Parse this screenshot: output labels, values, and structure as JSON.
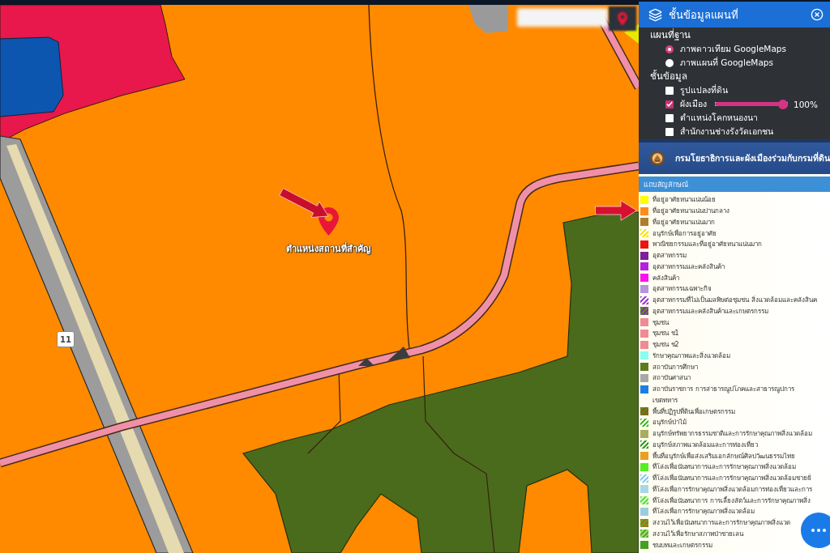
{
  "map": {
    "marker_label": "ตำแหน่งสถานที่สำคัญ",
    "road_shield": "11"
  },
  "layer_panel": {
    "title": "ชั้นข้อมูลแผนที่",
    "sections": [
      {
        "label": "แผนที่ฐาน",
        "items": [
          {
            "kind": "radio",
            "label": "ภาพดาวเทียม GoogleMaps",
            "selected": true
          },
          {
            "kind": "radio",
            "label": "ภาพแผนที่ GoogleMaps",
            "selected": false
          }
        ]
      },
      {
        "label": "ชั้นข้อมูล",
        "items": [
          {
            "kind": "checkbox",
            "label": "รูปแปลงที่ดิน",
            "checked": false
          },
          {
            "kind": "checkbox",
            "label": "ผังเมือง",
            "checked": true,
            "level": 1,
            "reading": "100%"
          },
          {
            "kind": "checkbox",
            "label": "ตำแหน่งโคกหนองนา",
            "checked": false
          },
          {
            "kind": "checkbox",
            "label": "สำนักงานช่างรังวัดเอกชน",
            "checked": false
          }
        ]
      }
    ]
  },
  "agency_banner": {
    "title": "กรมโยธาธิการและผังเมืองร่วมกับกรมที่ดิน"
  },
  "legend": {
    "title": "แถบสัญลักษณ์",
    "items": [
      {
        "kind": "solid",
        "label": "ที่อยู่อาศัยหนาแน่นน้อย",
        "color": "#ffff00"
      },
      {
        "kind": "solid",
        "label": "ที่อยู่อาศัยหนาแน่นปานกลาง",
        "color": "#ff8c1a"
      },
      {
        "kind": "solid",
        "label": "ที่อยู่อาศัยหนาแน่นมาก",
        "color": "#b07d2c"
      },
      {
        "kind": "hatched",
        "label": "อนุรักษ์เพื่อการอยู่อาศัย",
        "stripes": [
          {
            "color": "#f5e600"
          },
          {
            "color": "#ffffff"
          }
        ]
      },
      {
        "kind": "solid",
        "label": "พาณิชยกรรมและที่อยู่อาศัยหนาแน่นมาก",
        "color": "#ee1111"
      },
      {
        "kind": "solid",
        "label": "อุตสาหกรรม",
        "color": "#7a1f9a"
      },
      {
        "kind": "solid",
        "label": "อุตสาหกรรมและคลังสินค้า",
        "color": "#b51fe0"
      },
      {
        "kind": "solid",
        "label": "คลังสินค้า",
        "color": "#ff11ee"
      },
      {
        "kind": "solid",
        "label": "อุตสาหกรรมเฉพาะกิจ",
        "color": "#b594e0"
      },
      {
        "kind": "hatched",
        "label": "อุตสาหกรรมที่ไม่เป็นมลพิษต่อชุมชน สิ่งแวดล้อมและคลังสินค",
        "stripes": [
          {
            "color": "#9b3ee0"
          },
          {
            "color": "#ffffff"
          }
        ]
      },
      {
        "kind": "hatched",
        "label": "อุตสาหกรรมและคลังสินค้าและเกษตรกรรม",
        "stripes": [
          {
            "color": "#7a3a9a"
          },
          {
            "color": "#5a8a2a"
          }
        ]
      },
      {
        "kind": "solid",
        "label": "ชุมชน",
        "color": "#f08a95"
      },
      {
        "kind": "solid",
        "label": "ชุมชน ช1",
        "color": "#f08a95"
      },
      {
        "kind": "solid",
        "label": "ชุมชน ช2",
        "color": "#f08a95"
      },
      {
        "kind": "solid",
        "label": "รักษาคุณภาพและสิ่งแวดล้อม",
        "color": "#88ffee"
      },
      {
        "kind": "solid",
        "label": "สถาบันการศึกษา",
        "color": "#5b7a1e"
      },
      {
        "kind": "solid",
        "label": "สถาบันศาสนา",
        "color": "#a8a8a8"
      },
      {
        "kind": "solid",
        "label": "สถาบันราชการ การสาธารณูปโภคและสาธารณูปการ",
        "color": "#1c7ee6"
      },
      {
        "kind": "blank",
        "label": "เขตทหาร"
      },
      {
        "kind": "hatched",
        "label": "พื้นที่ปฏิรูปที่ดินเพื่อเกษตรกรรม",
        "stripes": [
          {
            "color": "#8a5a1a"
          },
          {
            "color": "#5a8a1a"
          }
        ]
      },
      {
        "kind": "hatched",
        "label": "อนุรักษ์ป่าไม้",
        "stripes": [
          {
            "color": "#44bb22"
          },
          {
            "color": "#ffffff"
          }
        ]
      },
      {
        "kind": "hatched",
        "label": "อนุรักษ์ทรัพยากรธรรมชาติและการรักษาคุณภาพสิ่งแวดล้อม",
        "stripes": [
          {
            "color": "#c8a050"
          },
          {
            "color": "#88bb66"
          }
        ]
      },
      {
        "kind": "hatched",
        "label": "อนุรักษ์สภาพแวดล้อมและการท่องเที่ยว",
        "stripes": [
          {
            "color": "#3a9a22"
          },
          {
            "color": "#f4fff0"
          }
        ]
      },
      {
        "kind": "solid",
        "label": "พื้นที่อนุรักษ์เพื่อส่งเสริมเอกลักษณ์ศิลปวัฒนธรรมไทย",
        "color": "#e8a020"
      },
      {
        "kind": "solid",
        "label": "ที่โล่งเพื่อนันทนาการและการรักษาคุณภาพสิ่งแวดล้อม",
        "color": "#55ee22"
      },
      {
        "kind": "hatched",
        "label": "ที่โล่งเพื่อนันทนาการและการรักษาคุณภาพสิ่งแวดล้อมชายฝั่",
        "stripes": [
          {
            "color": "#88ccee"
          },
          {
            "color": "#fafeff"
          }
        ]
      },
      {
        "kind": "solid",
        "label": "ที่โล่งเพื่อการรักษาคุณภาพสิ่งแวดล้อมการท่องเที่ยวและการ",
        "color": "#a8d8e8"
      },
      {
        "kind": "hatched",
        "label": "ที่โล่งเพื่อนันทนาการ การเลี้ยงสัตว์และการรักษาคุณภาพสิ่ง",
        "stripes": [
          {
            "color": "#66dd44"
          },
          {
            "color": "#ccffcc"
          }
        ]
      },
      {
        "kind": "solid",
        "label": "ที่โล่งเพื่อการรักษาคุณภาพสิ่งแวดล้อม",
        "color": "#9acce0"
      },
      {
        "kind": "hatched",
        "label": "สงวนไว้เพื่อนันทนาการและการรักษาคุณภาพสิ่งแวด",
        "stripes": [
          {
            "color": "#a07020"
          },
          {
            "color": "#66aa22"
          }
        ]
      },
      {
        "kind": "hatched",
        "label": "สงวนไว้เพื่อรักษาสภาพป่าชายเลน",
        "stripes": [
          {
            "color": "#55aa33"
          },
          {
            "color": "#99dd66"
          }
        ]
      },
      {
        "kind": "solid",
        "label": "ชนบทและเกษตรกรรม",
        "color": "#44a022"
      }
    ]
  }
}
